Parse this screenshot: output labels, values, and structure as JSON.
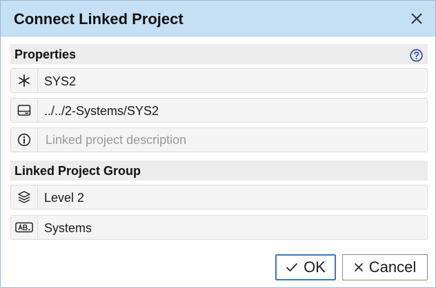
{
  "dialog": {
    "title": "Connect Linked Project",
    "close_icon": "close-icon"
  },
  "properties": {
    "header": "Properties",
    "help_icon": "help-icon",
    "name": {
      "icon": "asterisk-icon",
      "value": "SYS2"
    },
    "path": {
      "icon": "drive-icon",
      "value": "../../2-Systems/SYS2"
    },
    "description": {
      "icon": "info-icon",
      "value": "",
      "placeholder": "Linked project description"
    }
  },
  "group": {
    "header": "Linked Project Group",
    "level": {
      "icon": "layers-icon",
      "value": "Level 2"
    },
    "category": {
      "icon": "text-field-icon",
      "value": "Systems"
    }
  },
  "buttons": {
    "ok_label": "OK",
    "cancel_label": "Cancel"
  },
  "colors": {
    "titlebar": "#c5e0f5",
    "accent": "#3a78b5",
    "help_blue": "#1a3fbf"
  }
}
